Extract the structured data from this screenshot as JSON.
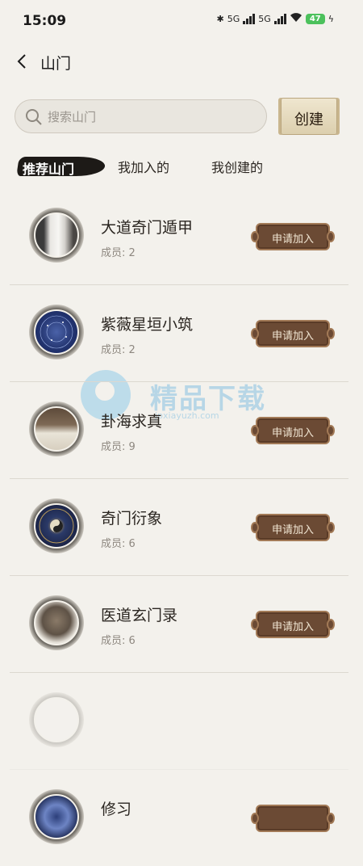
{
  "status": {
    "time": "15:09",
    "net1": "5G",
    "net2": "5G",
    "battery": "47"
  },
  "header": {
    "title": "山门"
  },
  "search": {
    "placeholder": "搜索山门"
  },
  "create_label": "创建",
  "tabs": [
    {
      "label": "推荐山门"
    },
    {
      "label": "我加入的"
    },
    {
      "label": "我创建的"
    }
  ],
  "items": [
    {
      "name": "大道奇门遁甲",
      "members": "成员: 2",
      "join": "申请加入",
      "avatar": "white-haired-figure"
    },
    {
      "name": "紫薇星垣小筑",
      "members": "成员: 2",
      "join": "申请加入",
      "avatar": "star-chart"
    },
    {
      "name": "卦海求真",
      "members": "成员: 9",
      "join": "申请加入",
      "avatar": "street-stall"
    },
    {
      "name": "奇门衍象",
      "members": "成员: 6",
      "join": "申请加入",
      "avatar": "bagua-compass"
    },
    {
      "name": "医道玄门录",
      "members": "成员: 6",
      "join": "申请加入",
      "avatar": "cat"
    },
    {
      "name": "",
      "members": "",
      "join": "",
      "avatar": "blank"
    },
    {
      "name": "修习",
      "members": "",
      "join": "",
      "avatar": "eye-pattern"
    }
  ],
  "watermark": {
    "text": "精品下载",
    "sub": "jpxiayuzh.com"
  }
}
